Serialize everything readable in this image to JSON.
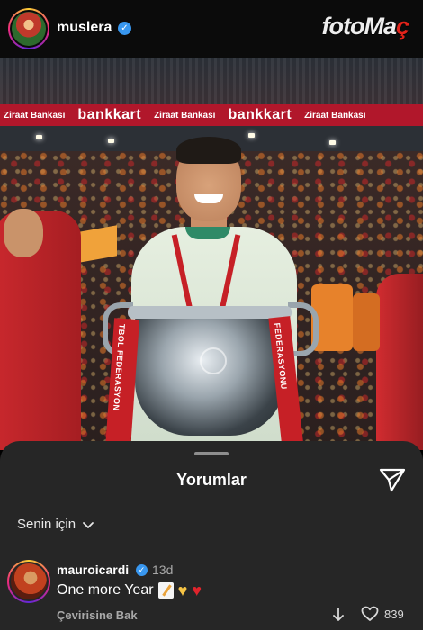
{
  "header": {
    "username": "muslera",
    "brand_primary": "fotoMa",
    "brand_accent": "ç"
  },
  "photo": {
    "ad_small": "Ziraat Bankası",
    "ad_big": "bankkart",
    "ribbon_left": "TBOL FEDERASYON",
    "ribbon_right": "FEDERASYONU"
  },
  "comments": {
    "title": "Yorumlar",
    "filter_label": "Senin için",
    "items": [
      {
        "user": "mauroicardi",
        "time": "13d",
        "text": "One more Year",
        "translate_label": "Çevirisine Bak",
        "like_count": "839"
      }
    ]
  },
  "icons": {
    "send": "send-icon",
    "chevron": "chevron-down-icon",
    "down": "arrow-down-icon",
    "like": "heart-icon",
    "verified": "verified-badge-icon"
  },
  "colors": {
    "sheet_bg": "#262626",
    "verified_blue": "#3897f0",
    "brand_red": "#e2231a",
    "ad_board_red": "#b1172b"
  }
}
